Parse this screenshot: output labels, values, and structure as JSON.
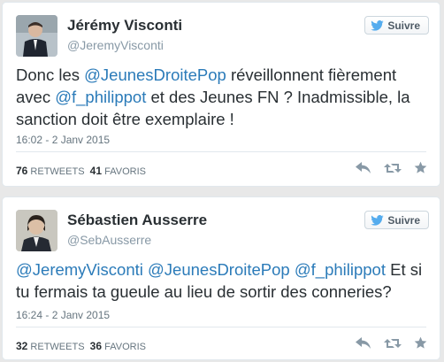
{
  "follow_label": "Suivre",
  "colors": {
    "mention": "#2b7bb9",
    "follow_bird": "#55acee",
    "action_icons": "#8899a6"
  },
  "tweets": [
    {
      "name": "Jérémy Visconti",
      "handle": "@JeremyVisconti",
      "text": {
        "p1": "Donc les ",
        "m1": "@JeunesDroitePop",
        "p2": " réveillonnent fièrement avec ",
        "m2": "@f_philippot",
        "p3": " et des Jeunes FN ? Inadmissible, la sanction doit être exemplaire !"
      },
      "timestamp": "16:02 - 2 Janv 2015",
      "retweets": "76",
      "retweets_label": "RETWEETS",
      "favorites": "41",
      "favorites_label": "FAVORIS"
    },
    {
      "name": "Sébastien Ausserre",
      "handle": "@SebAusserre",
      "text": {
        "m1": "@JeremyVisconti",
        "p1": " ",
        "m2": "@JeunesDroitePop",
        "p2": " ",
        "m3": "@f_philippot",
        "p3": " Et si tu fermais ta gueule au lieu de sortir des conneries?"
      },
      "timestamp": "16:24 - 2 Janv 2015",
      "retweets": "32",
      "retweets_label": "RETWEETS",
      "favorites": "36",
      "favorites_label": "FAVORIS"
    }
  ]
}
